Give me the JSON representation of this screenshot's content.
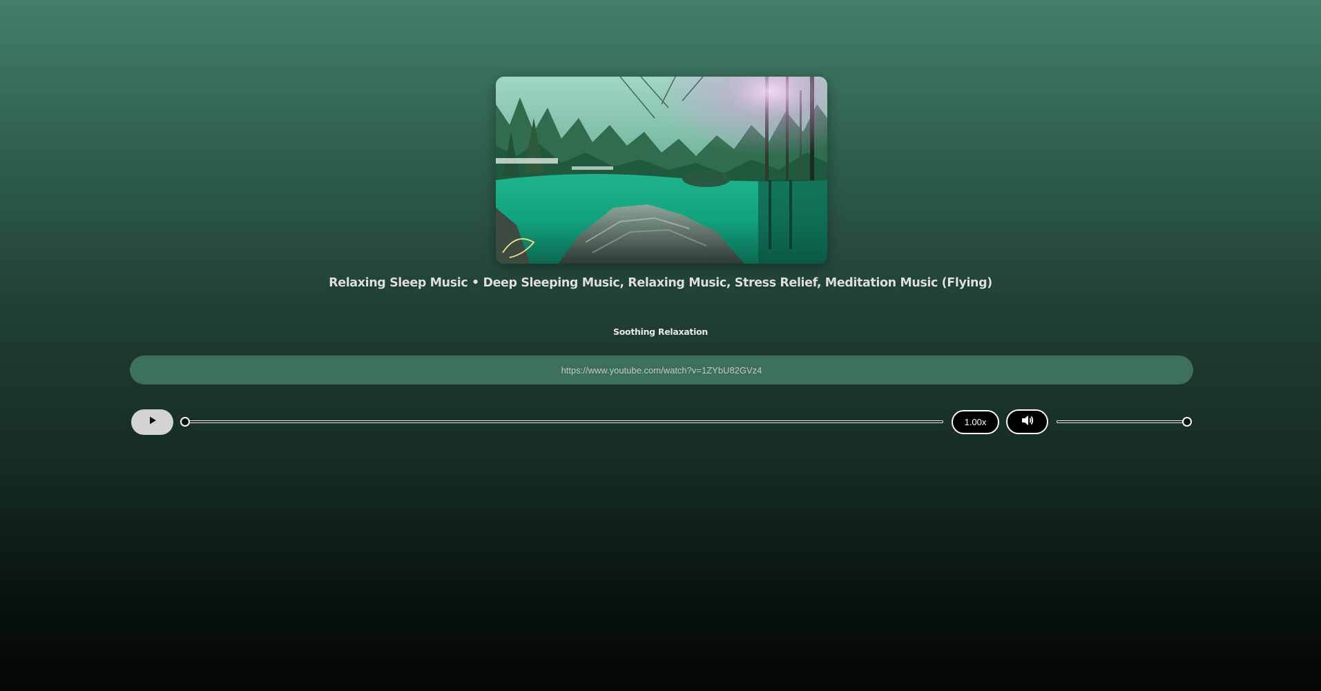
{
  "video": {
    "title": "Relaxing Sleep Music • Deep Sleeping Music, Relaxing Music, Stress Relief, Meditation Music (Flying)",
    "channel": "Soothing Relaxation",
    "thumbnail_icon": "forest-lake-thumbnail"
  },
  "url": {
    "value": "https://www.youtube.com/watch?v=1ZYbU82GVz4"
  },
  "controls": {
    "play_icon": "play-icon",
    "playback_progress": 0,
    "speed_label": "1.00x",
    "volume_icon": "speaker-icon",
    "volume_level": 1.0
  },
  "colors": {
    "background_top": "#427f68",
    "background_bottom": "#030605",
    "url_bar": "#3c7059",
    "play_button": "#d3d3d3"
  }
}
